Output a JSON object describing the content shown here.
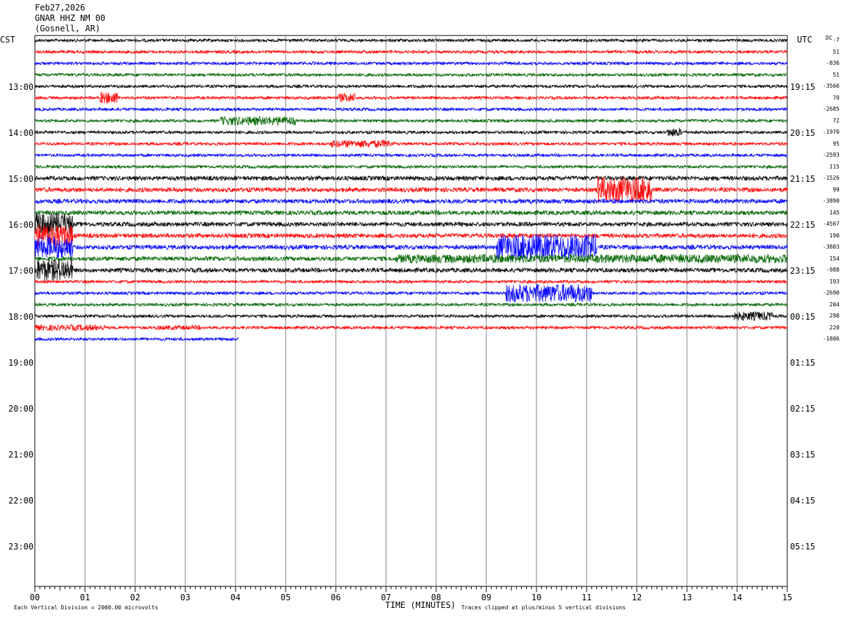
{
  "header": {
    "date": "Feb27,2026",
    "station": "GNAR HHZ NM 00",
    "location": "(Gosnell, AR)"
  },
  "labels": {
    "left_tz": "CST",
    "right_tz": "UTC",
    "dc": "DC",
    "xlabel": "TIME (MINUTES)",
    "scale_note": "Each Vertical Division = 2000.00 microvolts",
    "clip_note": "Traces clipped at plus/minus 5 vertical divisions"
  },
  "colors": {
    "trace_cycle": [
      "#000000",
      "#ff0000",
      "#0000ff",
      "#006400"
    ],
    "grid": "#808080"
  },
  "chart_data": {
    "type": "line",
    "title": "",
    "xlabel": "TIME (MINUTES)",
    "xlim": [
      0,
      15
    ],
    "x_ticks": [
      "00",
      "01",
      "02",
      "03",
      "04",
      "05",
      "06",
      "07",
      "08",
      "09",
      "10",
      "11",
      "12",
      "13",
      "14",
      "15"
    ],
    "left_hour_labels": [
      "13:00",
      "14:00",
      "15:00",
      "16:00",
      "17:00",
      "18:00",
      "19:00",
      "20:00",
      "21:00",
      "22:00",
      "23:00"
    ],
    "right_hour_labels": [
      "19:15",
      "20:15",
      "21:15",
      "22:15",
      "23:15",
      "00:15",
      "01:15",
      "02:15",
      "03:15",
      "04:15",
      "05:15"
    ],
    "trace_count": 27,
    "last_trace_minutes": 4.05,
    "dc_offsets": [
      "-7",
      "51",
      "-836",
      "51",
      "-3566",
      "70",
      "-2685",
      "72",
      "-1970",
      "95",
      "-2593",
      "115",
      "-1526",
      "99",
      "-3890",
      "145",
      "-4567",
      "190",
      "-3803",
      "154",
      "-988",
      "193",
      "-2690",
      "204",
      "298",
      "220",
      "-1806"
    ],
    "bursts": [
      {
        "trace": 5,
        "x_start": 1.3,
        "x_end": 1.65,
        "amp": 4
      },
      {
        "trace": 5,
        "x_start": 6.05,
        "x_end": 6.4,
        "amp": 3
      },
      {
        "trace": 7,
        "x_start": 3.7,
        "x_end": 5.2,
        "amp": 3
      },
      {
        "trace": 9,
        "x_start": 5.9,
        "x_end": 7.1,
        "amp": 2.5
      },
      {
        "trace": 8,
        "x_start": 12.6,
        "x_end": 12.9,
        "amp": 3
      },
      {
        "trace": 13,
        "x_start": 11.2,
        "x_end": 12.3,
        "amp": 6
      },
      {
        "trace": 16,
        "x_start": 0.0,
        "x_end": 0.75,
        "amp": 5
      },
      {
        "trace": 17,
        "x_start": 0.0,
        "x_end": 0.75,
        "amp": 5
      },
      {
        "trace": 18,
        "x_start": 0.0,
        "x_end": 0.75,
        "amp": 5
      },
      {
        "trace": 20,
        "x_start": 0.0,
        "x_end": 0.75,
        "amp": 5
      },
      {
        "trace": 19,
        "x_start": 7.2,
        "x_end": 15.0,
        "amp": 2
      },
      {
        "trace": 18,
        "x_start": 9.2,
        "x_end": 11.2,
        "amp": 6
      },
      {
        "trace": 22,
        "x_start": 9.4,
        "x_end": 11.1,
        "amp": 6
      },
      {
        "trace": 24,
        "x_start": 13.9,
        "x_end": 14.7,
        "amp": 3
      },
      {
        "trace": 25,
        "x_start": 0.0,
        "x_end": 1.4,
        "amp": 2
      },
      {
        "trace": 25,
        "x_start": 2.4,
        "x_end": 3.3,
        "amp": 1.5
      }
    ]
  }
}
